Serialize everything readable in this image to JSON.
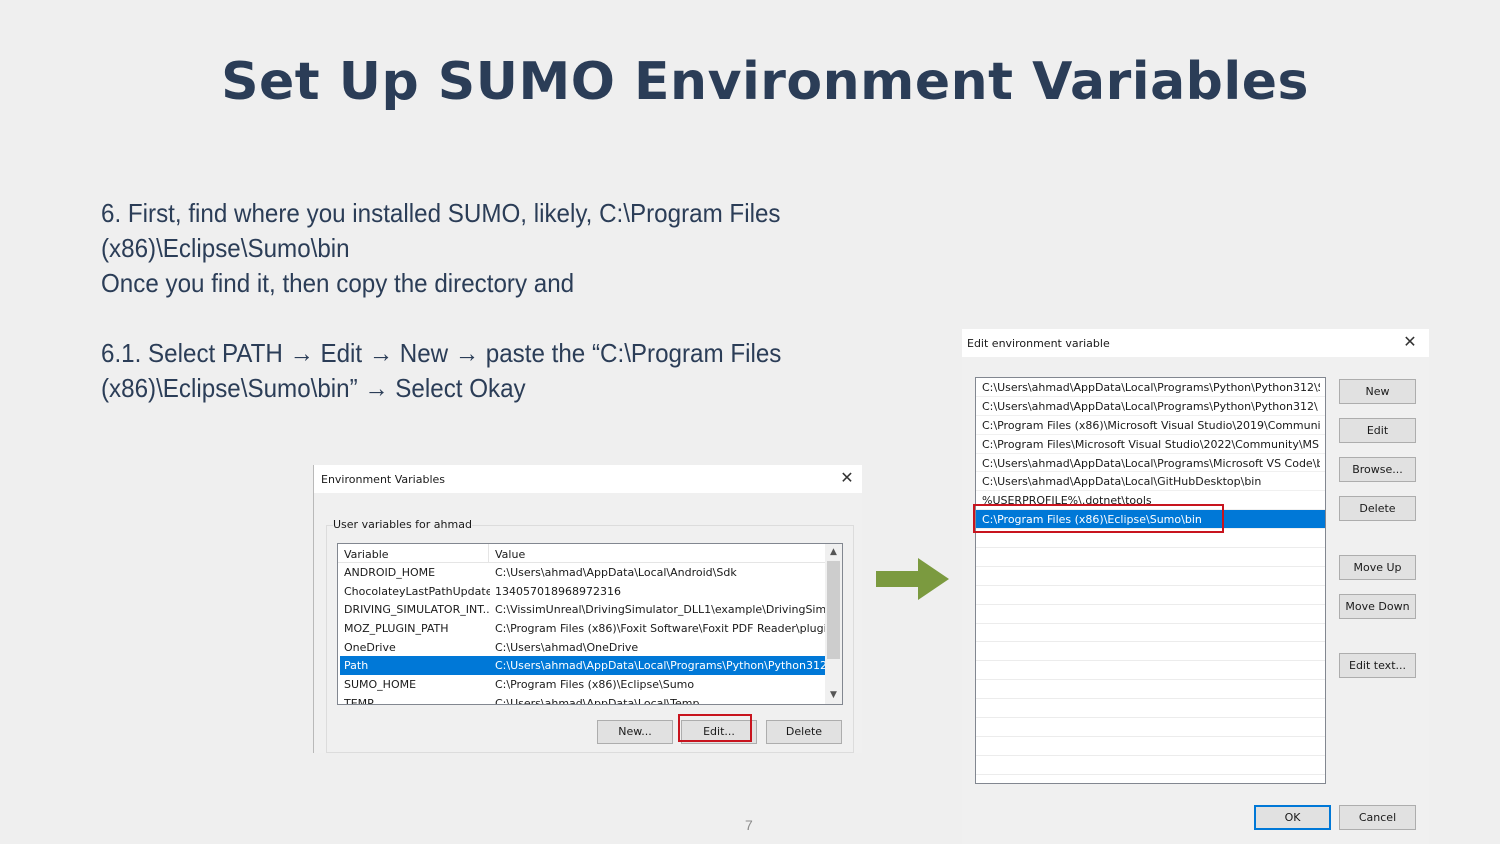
{
  "slide": {
    "title": "Set Up SUMO Environment Variables",
    "step6": {
      "line1": "6. First, find where you installed SUMO, likely, C:\\Program Files",
      "line2": "(x86)\\Eclipse\\Sumo\\bin",
      "line3": "Once you find it, then copy the directory and"
    },
    "step61": {
      "line1": "6.1. Select PATH → Edit → New → paste the “C:\\Program Files",
      "line2": "(x86)\\Eclipse\\Sumo\\bin” → Select Okay"
    },
    "page_number": "7",
    "arrow_color": "#7b9a3f",
    "highlight_color": "#c8141e"
  },
  "env_dialog": {
    "title": "Environment Variables",
    "group_label": "User variables for ahmad",
    "columns": {
      "variable": "Variable",
      "value": "Value"
    },
    "rows": [
      {
        "variable": "ANDROID_HOME",
        "value": "C:\\Users\\ahmad\\AppData\\Local\\Android\\Sdk"
      },
      {
        "variable": "ChocolateyLastPathUpdate",
        "value": "134057018968972316"
      },
      {
        "variable": "DRIVING_SIMULATOR_INT...",
        "value": "C:\\VissimUnreal\\DrivingSimulator_DLL1\\example\\DrivingSim..."
      },
      {
        "variable": "MOZ_PLUGIN_PATH",
        "value": "C:\\Program Files (x86)\\Foxit Software\\Foxit PDF Reader\\plugi..."
      },
      {
        "variable": "OneDrive",
        "value": "C:\\Users\\ahmad\\OneDrive"
      },
      {
        "variable": "Path",
        "value": "C:\\Users\\ahmad\\AppData\\Local\\Programs\\Python\\Python312...",
        "selected": true
      },
      {
        "variable": "SUMO_HOME",
        "value": "C:\\Program Files (x86)\\Eclipse\\Sumo"
      },
      {
        "variable": "TEMP",
        "value": "C:\\Users\\ahmad\\AppData\\Local\\Temp"
      }
    ],
    "buttons": {
      "new": "New...",
      "edit": "Edit...",
      "delete": "Delete"
    }
  },
  "edit_dialog": {
    "title": "Edit environment variable",
    "paths": [
      "C:\\Users\\ahmad\\AppData\\Local\\Programs\\Python\\Python312\\S...",
      "C:\\Users\\ahmad\\AppData\\Local\\Programs\\Python\\Python312\\",
      "C:\\Program Files (x86)\\Microsoft Visual Studio\\2019\\Community...",
      "C:\\Program Files\\Microsoft Visual Studio\\2022\\Community\\MSB...",
      "C:\\Users\\ahmad\\AppData\\Local\\Programs\\Microsoft VS Code\\b...",
      "C:\\Users\\ahmad\\AppData\\Local\\GitHubDesktop\\bin",
      "%USERPROFILE%\\.dotnet\\tools",
      "C:\\Program Files (x86)\\Eclipse\\Sumo\\bin"
    ],
    "selected_index": 7,
    "buttons": {
      "new": "New",
      "edit": "Edit",
      "browse": "Browse...",
      "delete": "Delete",
      "move_up": "Move Up",
      "move_down": "Move Down",
      "edit_text": "Edit text...",
      "ok": "OK",
      "cancel": "Cancel"
    }
  }
}
